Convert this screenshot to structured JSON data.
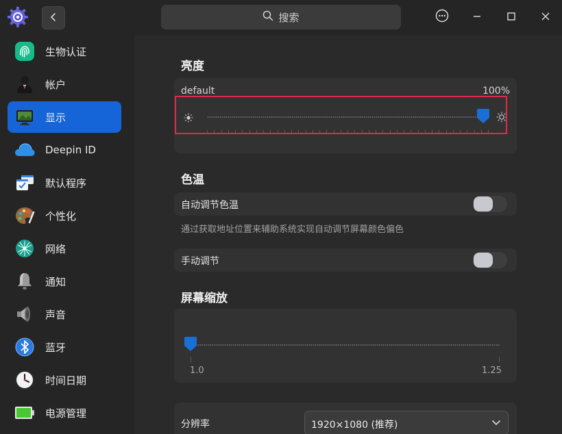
{
  "titlebar": {
    "search_placeholder": "搜索"
  },
  "sidebar": {
    "items": [
      {
        "label": "生物认证",
        "icon": "fingerprint-icon"
      },
      {
        "label": "帐户",
        "icon": "account-icon"
      },
      {
        "label": "显示",
        "icon": "display-icon",
        "active": true
      },
      {
        "label": "Deepin ID",
        "icon": "cloud-icon"
      },
      {
        "label": "默认程序",
        "icon": "default-apps-icon"
      },
      {
        "label": "个性化",
        "icon": "palette-icon"
      },
      {
        "label": "网络",
        "icon": "network-icon"
      },
      {
        "label": "通知",
        "icon": "bell-icon"
      },
      {
        "label": "声音",
        "icon": "speaker-icon"
      },
      {
        "label": "蓝牙",
        "icon": "bluetooth-icon"
      },
      {
        "label": "时间日期",
        "icon": "clock-icon"
      },
      {
        "label": "电源管理",
        "icon": "battery-icon"
      }
    ]
  },
  "brightness": {
    "title": "亮度",
    "monitor_name": "default",
    "value_text": "100%",
    "value_fraction": 1.0
  },
  "color_temp": {
    "title": "色温",
    "auto_label": "自动调节色温",
    "auto_hint": "通过获取地址位置来辅助系统实现自动调节屏幕颜色偏色",
    "auto_enabled": false,
    "manual_label": "手动调节",
    "manual_enabled": false
  },
  "scaling": {
    "title": "屏幕缩放",
    "min_label": "1.0",
    "max_label": "1.25",
    "value": 1.0
  },
  "resolution": {
    "label": "分辨率",
    "selected": "1920×1080 (推荐)"
  },
  "colors": {
    "accent": "#1565d8",
    "highlight_border": "#e0294c"
  }
}
